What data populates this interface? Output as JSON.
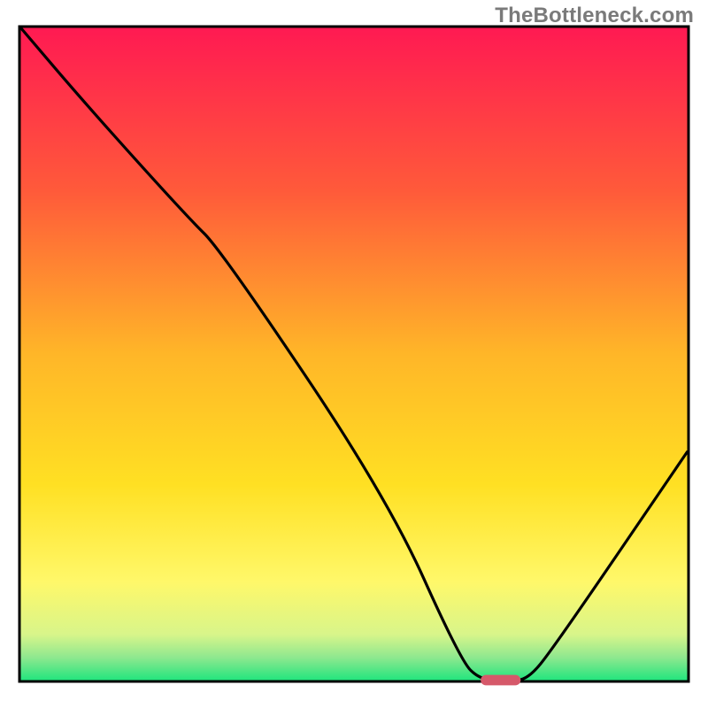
{
  "watermark": "TheBottleneck.com",
  "chart_data": {
    "type": "line",
    "title": "",
    "xlabel": "",
    "ylabel": "",
    "xlim": [
      0,
      100
    ],
    "ylim": [
      0,
      100
    ],
    "axes_visible": false,
    "legend": null,
    "background_gradient": {
      "stops": [
        {
          "pos": 0.0,
          "color": "#ff1a52"
        },
        {
          "pos": 0.25,
          "color": "#ff5a3a"
        },
        {
          "pos": 0.5,
          "color": "#ffb628"
        },
        {
          "pos": 0.7,
          "color": "#ffe023"
        },
        {
          "pos": 0.85,
          "color": "#fff86a"
        },
        {
          "pos": 0.93,
          "color": "#d8f58a"
        },
        {
          "pos": 0.965,
          "color": "#8fe88f"
        },
        {
          "pos": 1.0,
          "color": "#23e57e"
        }
      ]
    },
    "series": [
      {
        "name": "bottleneck-curve",
        "color": "#000000",
        "x": [
          0,
          10,
          25,
          30,
          55,
          66,
          69,
          73,
          76,
          80,
          100
        ],
        "y": [
          100,
          88,
          71,
          66,
          28,
          3,
          0,
          0,
          0,
          5,
          35
        ]
      }
    ],
    "marker": {
      "name": "optimal-range",
      "shape": "rounded-rect",
      "color": "#d6596a",
      "x_center": 72,
      "y_center": 0,
      "width_x": 6,
      "height_y": 1.6
    }
  }
}
